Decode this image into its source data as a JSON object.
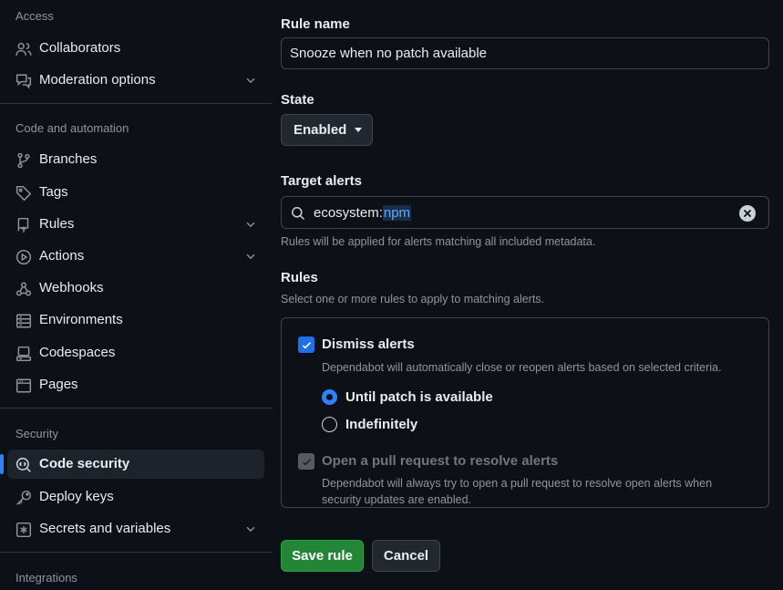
{
  "sidebar": {
    "sections": {
      "access": "Access",
      "code_automation": "Code and automation",
      "security": "Security",
      "integrations": "Integrations"
    },
    "items": {
      "collaborators": "Collaborators",
      "moderation": "Moderation options",
      "branches": "Branches",
      "tags": "Tags",
      "rules": "Rules",
      "actions": "Actions",
      "webhooks": "Webhooks",
      "environments": "Environments",
      "codespaces": "Codespaces",
      "pages": "Pages",
      "code_security": "Code security",
      "deploy_keys": "Deploy keys",
      "secrets": "Secrets and variables"
    },
    "active_item": "Code security"
  },
  "form": {
    "rule_name_label": "Rule name",
    "rule_name_value": "Snooze when no patch available",
    "state_label": "State",
    "state_value": "Enabled",
    "target_label": "Target alerts",
    "target_query_key": "ecosystem:",
    "target_query_value": "npm",
    "target_hint": "Rules will be applied for alerts matching all included metadata.",
    "rules_label": "Rules",
    "rules_hint": "Select one or more rules to apply to matching alerts.",
    "dismiss": {
      "label": "Dismiss alerts",
      "checked": true,
      "description": "Dependabot will automatically close or reopen alerts based on selected criteria.",
      "options": [
        {
          "label": "Until patch is available",
          "selected": true
        },
        {
          "label": "Indefinitely",
          "selected": false
        }
      ]
    },
    "pull_request": {
      "label": "Open a pull request to resolve alerts",
      "checked": true,
      "disabled": true,
      "description_line1": "Dependabot will always try to open a pull request to resolve open alerts when",
      "description_line2": "security updates are enabled."
    },
    "save_label": "Save rule",
    "cancel_label": "Cancel"
  },
  "colors": {
    "background": "#0d1117",
    "accent": "#2f81f7",
    "primary_button": "#238636",
    "border": "#3d444d"
  }
}
